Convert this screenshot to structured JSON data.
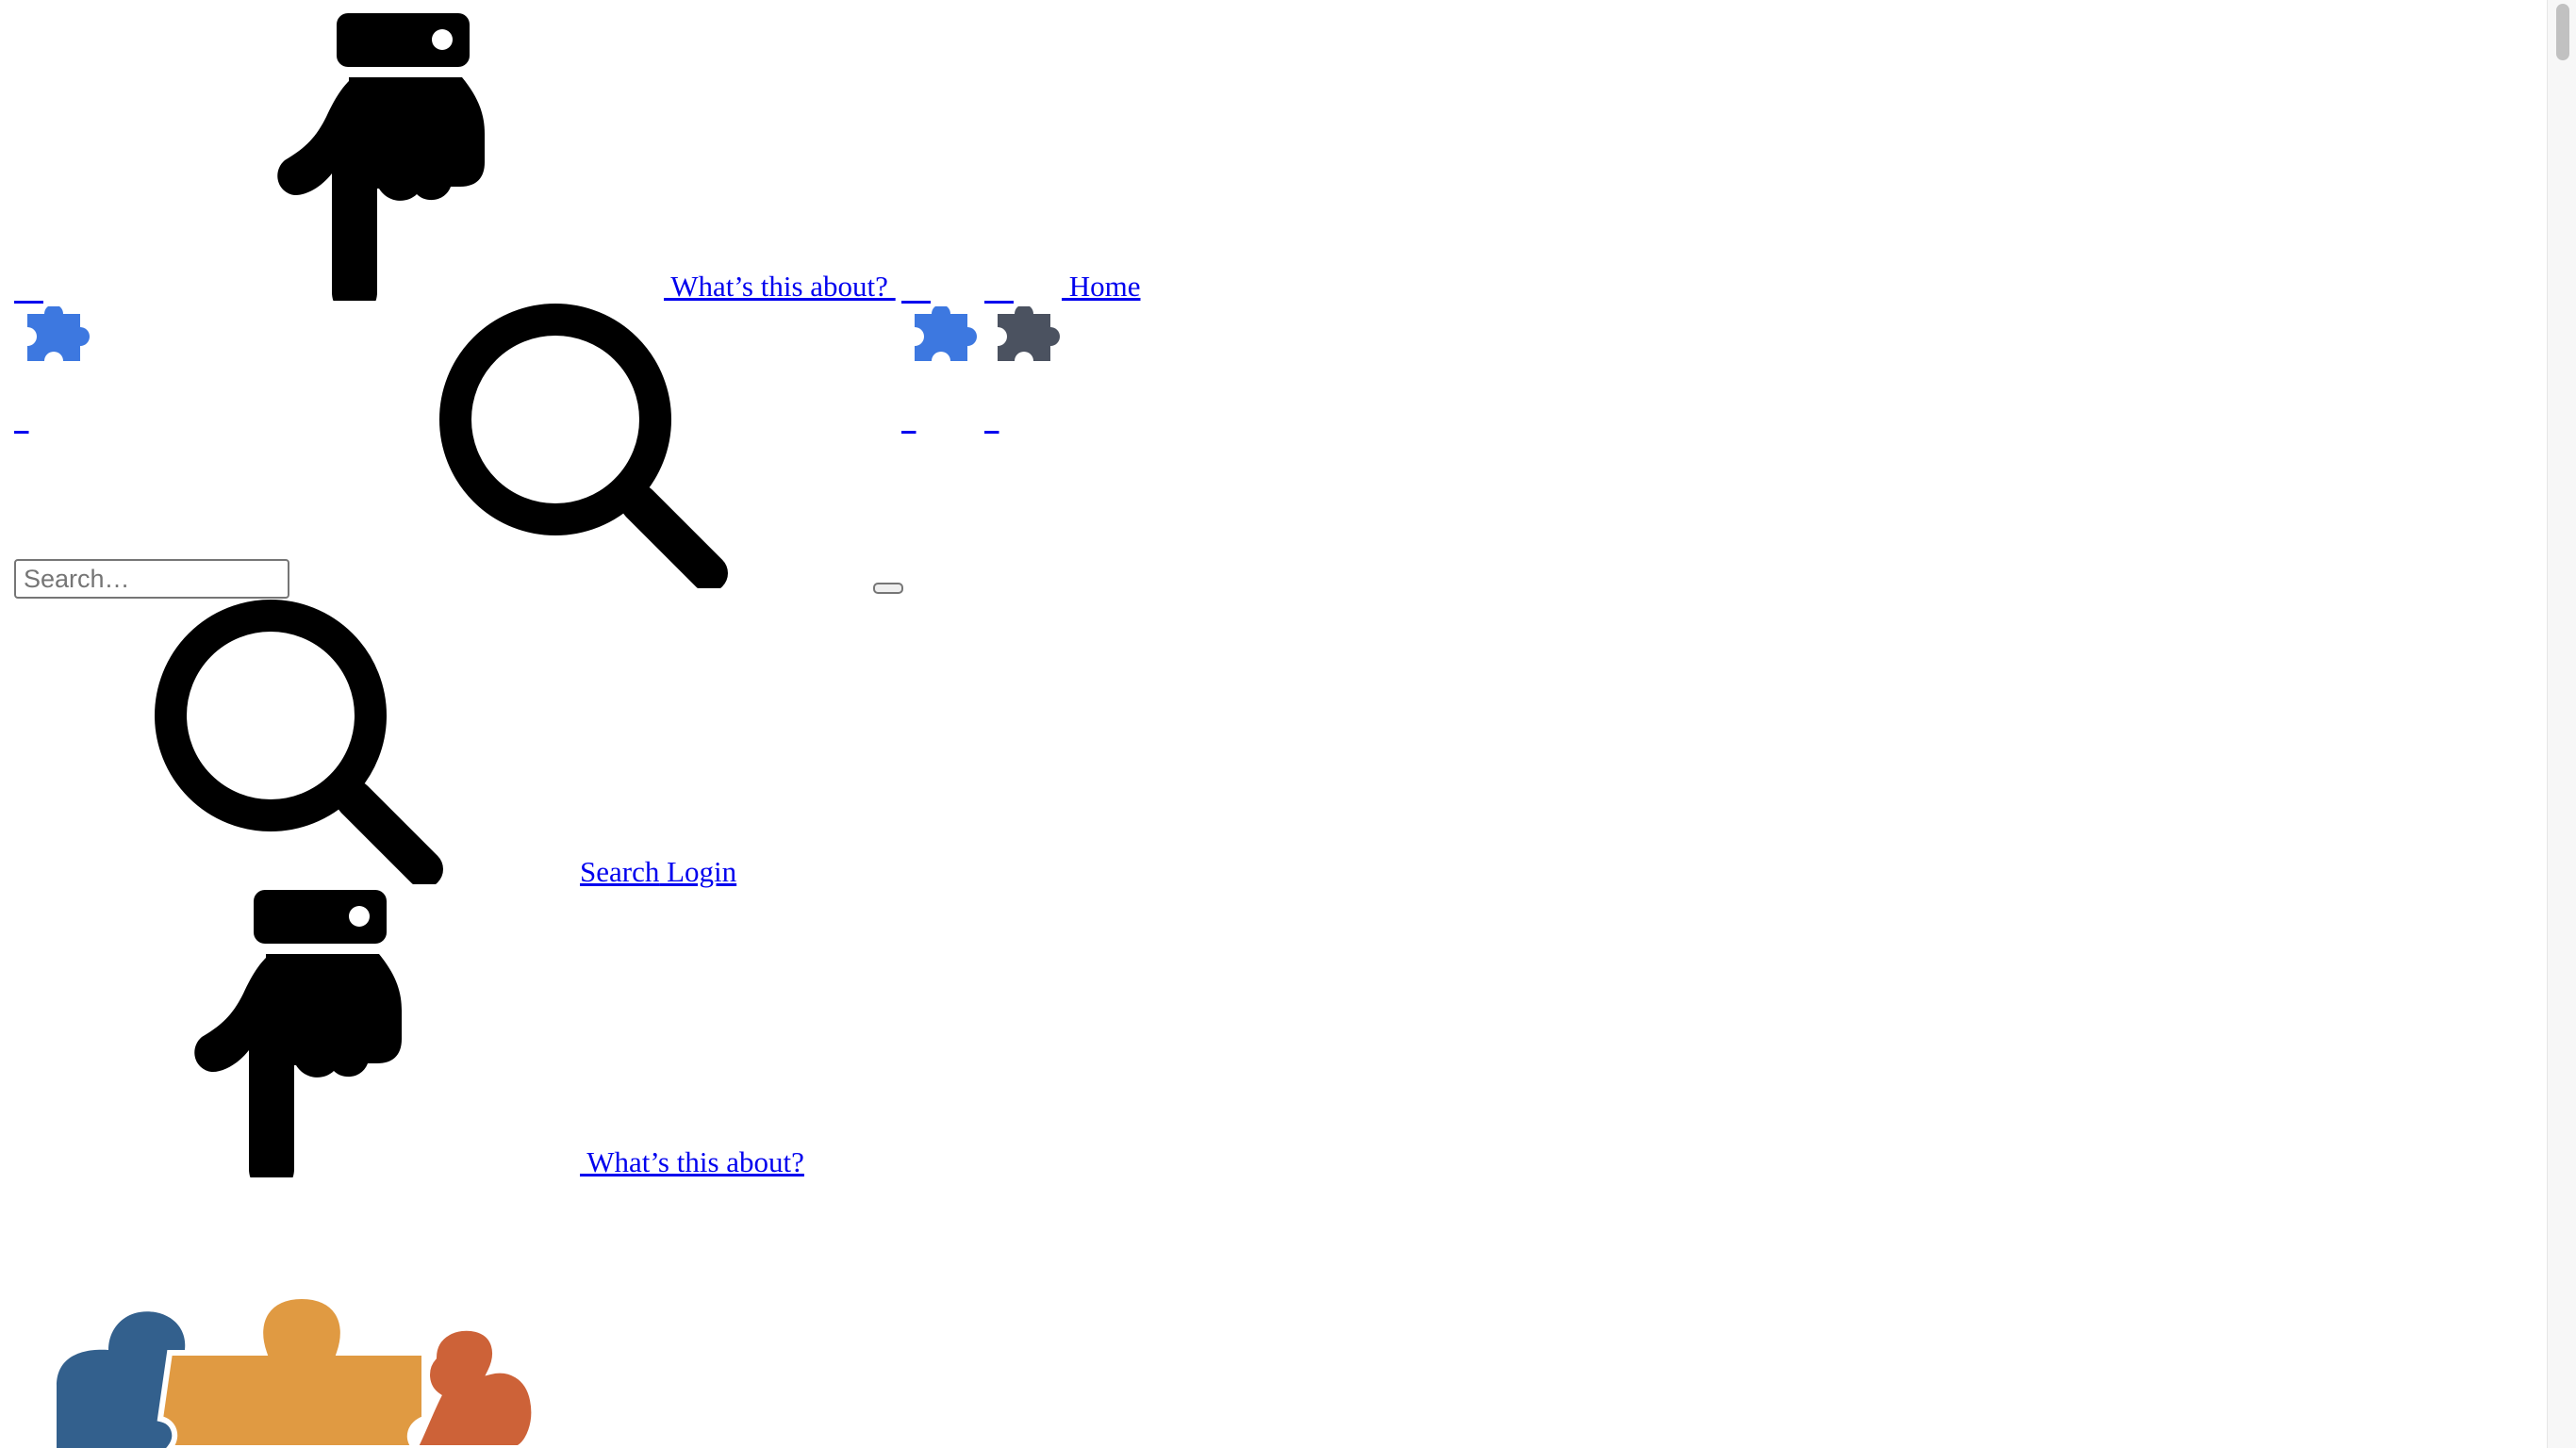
{
  "nav": {
    "about_label": " What’s this about? ",
    "home_label": " Home"
  },
  "search": {
    "placeholder": "Search…",
    "search_label": "Search",
    "login_label": " Login"
  },
  "secondary": {
    "about_label": " What’s this about?"
  },
  "colors": {
    "accent_blue": "#3d78e0",
    "slate": "#4b5260",
    "logo_blue": "#33608d",
    "logo_orange": "#e09a42",
    "logo_red": "#cd6238"
  },
  "icons": [
    "puzzle-icon",
    "pointing-hand-icon",
    "search-icon",
    "logo-puzzle"
  ]
}
